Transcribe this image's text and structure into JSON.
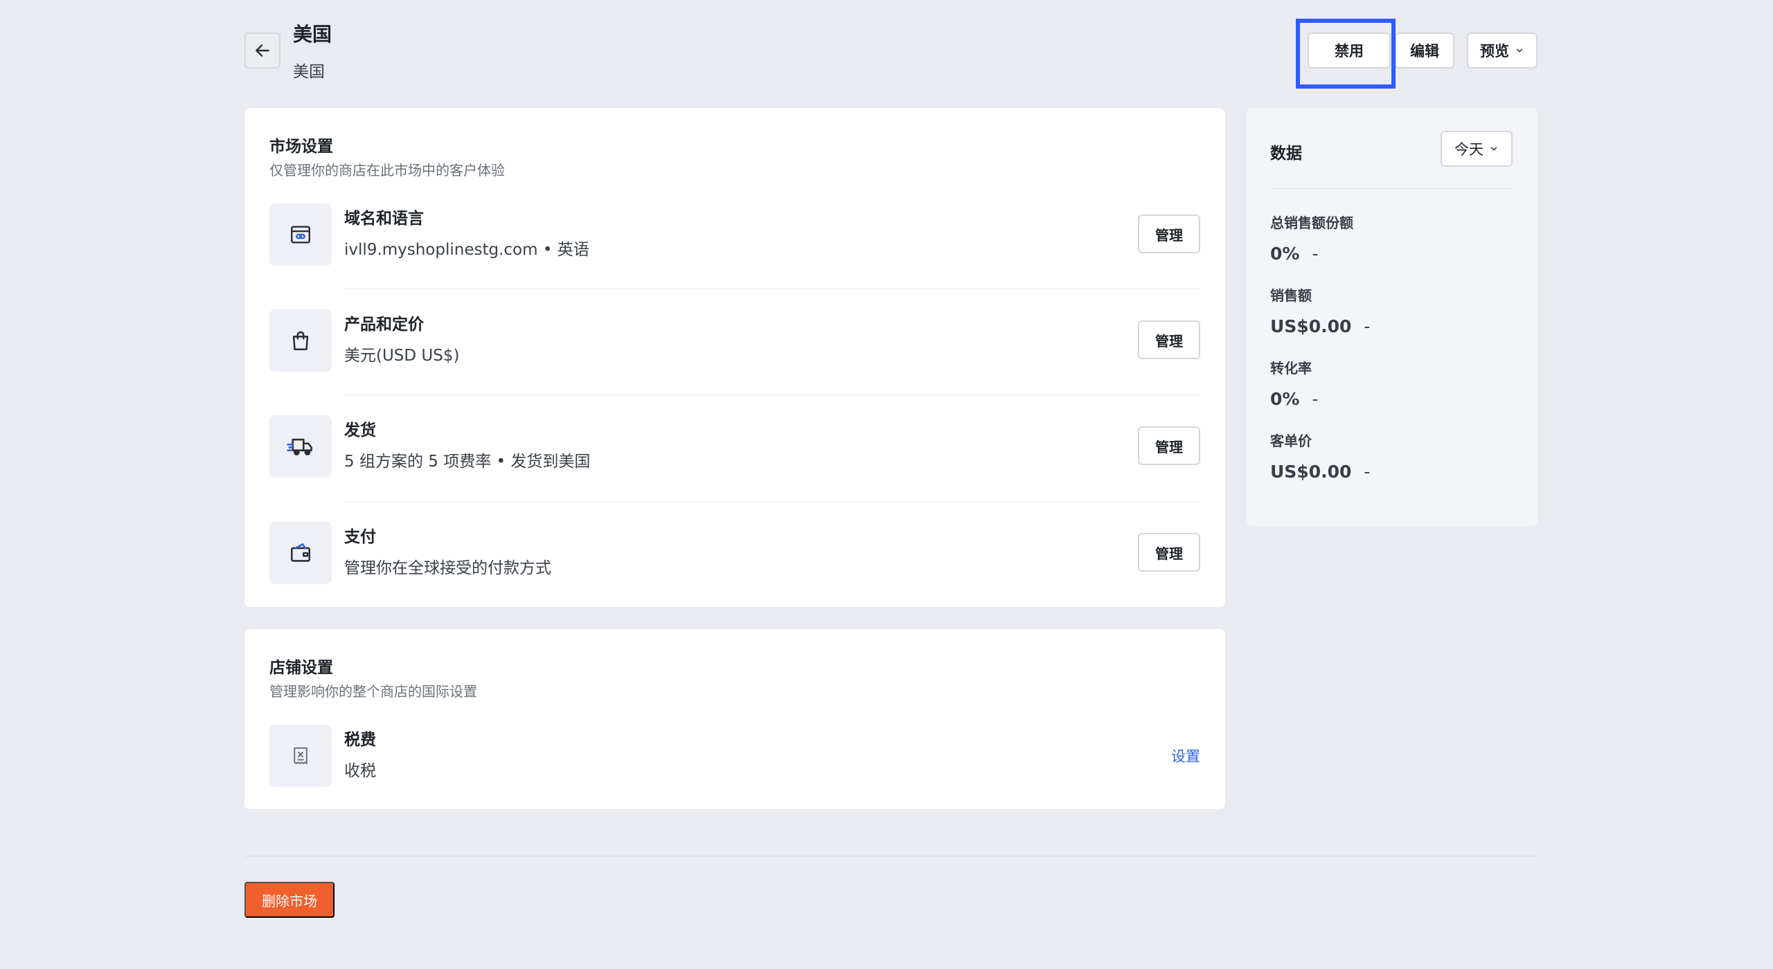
{
  "header": {
    "title": "美国",
    "subtitle": "美国",
    "back_icon": "arrow-left-icon",
    "buttons": {
      "disable": "禁用",
      "edit": "编辑",
      "preview": "预览"
    }
  },
  "market_settings": {
    "title": "市场设置",
    "description": "仅管理你的商店在此市场中的客户体验",
    "items": [
      {
        "icon": "browser-link-icon",
        "title": "域名和语言",
        "desc": "ivll9.myshoplinestg.com • 英语",
        "action": "管理"
      },
      {
        "icon": "shopping-bag-icon",
        "title": "产品和定价",
        "desc": "美元(USD US$)",
        "action": "管理"
      },
      {
        "icon": "delivery-truck-icon",
        "title": "发货",
        "desc": "5 组方案的 5 项费率 • 发货到美国",
        "action": "管理"
      },
      {
        "icon": "wallet-icon",
        "title": "支付",
        "desc": "管理你在全球接受的付款方式",
        "action": "管理"
      }
    ]
  },
  "store_settings": {
    "title": "店铺设置",
    "description": "管理影响你的整个商店的国际设置",
    "items": [
      {
        "icon": "receipt-tax-icon",
        "title": "税费",
        "desc": "收税",
        "action": "设置"
      }
    ]
  },
  "data_panel": {
    "title": "数据",
    "range": "今天",
    "metrics": [
      {
        "label": "总销售额份额",
        "value": "0%",
        "change": "-"
      },
      {
        "label": "销售额",
        "value": "US$0.00",
        "change": "-"
      },
      {
        "label": "转化率",
        "value": "0%",
        "change": "-"
      },
      {
        "label": "客单价",
        "value": "US$0.00",
        "change": "-"
      }
    ]
  },
  "footer": {
    "delete_label": "删除市场"
  },
  "colors": {
    "background": "#e9ebf0",
    "highlight": "#2f5bff",
    "danger": "#f0602f",
    "link": "#2f62e8"
  }
}
